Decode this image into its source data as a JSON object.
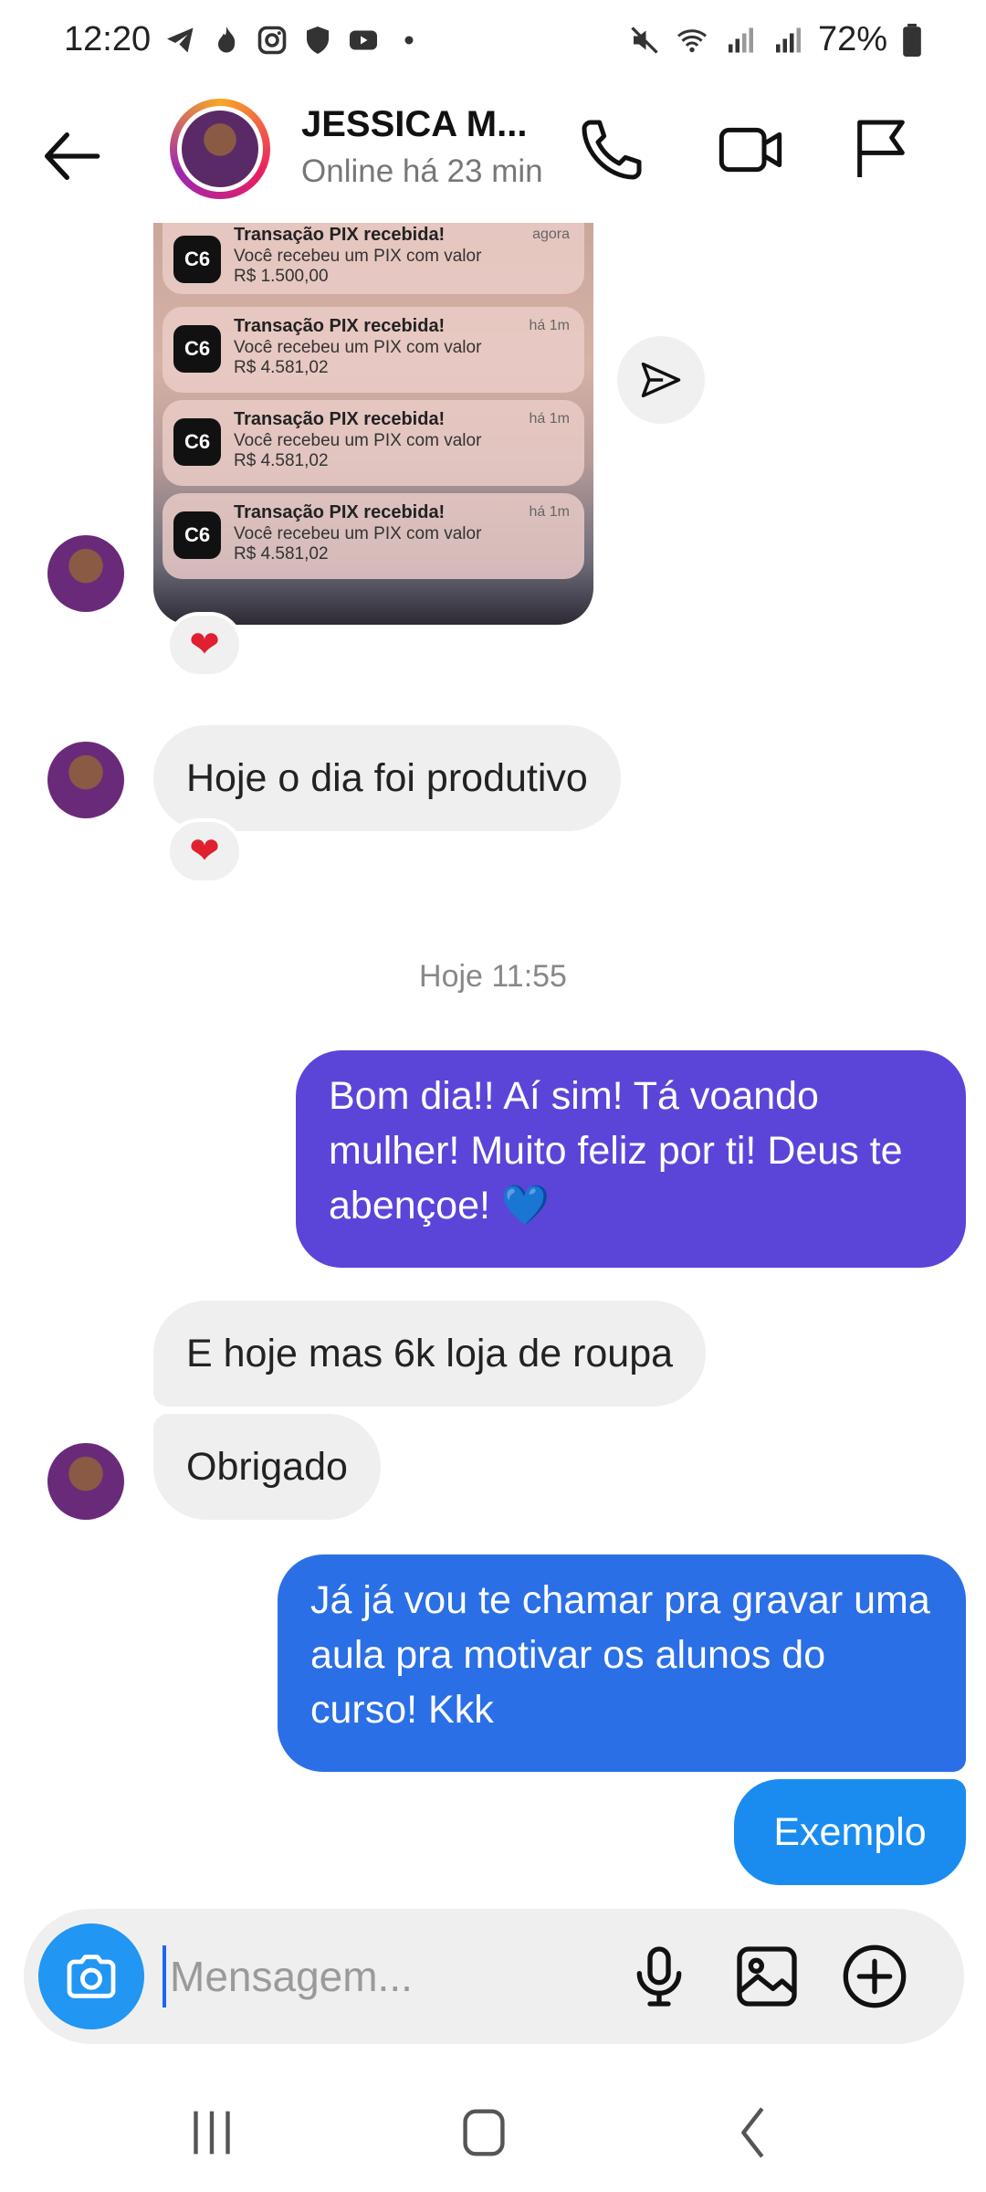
{
  "status_bar": {
    "time": "12:20",
    "battery": "72%"
  },
  "header": {
    "name": "JESSICA M...",
    "presence": "Online há 23 min"
  },
  "notifications": [
    {
      "logo": "C6",
      "title": "Transação PIX recebida!",
      "body": "Você recebeu um PIX com valor",
      "amount": "R$ 1.500,00",
      "time": "agora"
    },
    {
      "logo": "C6",
      "title": "Transação PIX recebida!",
      "body": "Você recebeu um PIX com valor",
      "amount": "R$ 4.581,02",
      "time": "há 1m"
    },
    {
      "logo": "C6",
      "title": "Transação PIX recebida!",
      "body": "Você recebeu um PIX com valor",
      "amount": "R$ 4.581,02",
      "time": "há 1m"
    },
    {
      "logo": "C6",
      "title": "Transação PIX recebida!",
      "body": "Você recebeu um PIX com valor",
      "amount": "R$ 4.581,02",
      "time": "há 1m"
    }
  ],
  "messages": {
    "in_1": "Hoje o dia foi produtivo",
    "timestamp": "Hoje 11:55",
    "out_1": "Bom dia!! Aí sim! Tá voando mulher! Muito feliz por ti! Deus te abençoe! 💙",
    "in_2": "E hoje mas 6k loja de roupa",
    "in_3": "Obrigado",
    "out_2": "Já já vou te chamar pra gravar uma aula pra motivar os alunos do curso! Kkk",
    "out_3": "Exemplo"
  },
  "reactions": {
    "photo": "❤",
    "in_1": "❤"
  },
  "composer": {
    "placeholder": "Mensagem..."
  },
  "colors": {
    "out_bubble_purple": "#5b45d9",
    "out_bubble_blue": "#2b6fe6",
    "out_bubble_light_blue": "#1a8cf0",
    "camera_button": "#2196f3",
    "in_bubble": "#efefef"
  }
}
